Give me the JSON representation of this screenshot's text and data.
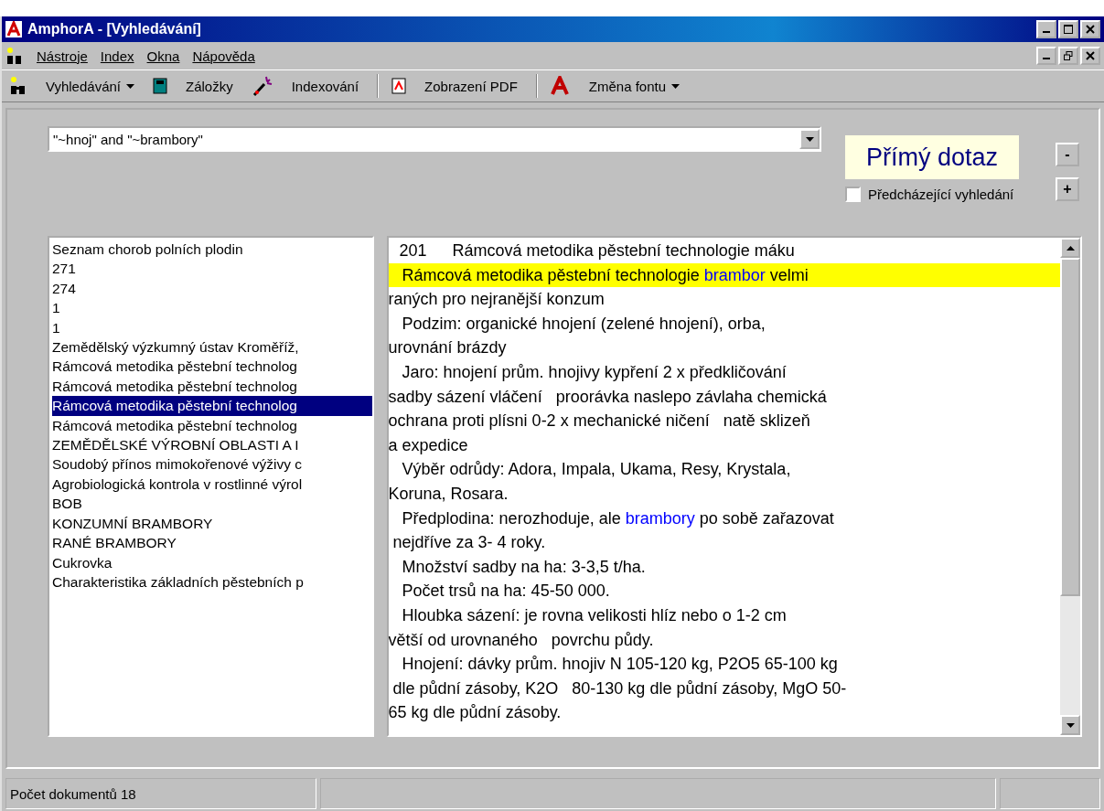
{
  "window": {
    "title": "AmphorA - [Vyhledávání]"
  },
  "menu": [
    {
      "label": "Nástroje"
    },
    {
      "label": "Index"
    },
    {
      "label": "Okna"
    },
    {
      "label": "Nápověda"
    }
  ],
  "toolbar": [
    {
      "kind": "icon"
    },
    {
      "kind": "dropdown",
      "label": "Vyhledávání"
    },
    {
      "kind": "icon"
    },
    {
      "kind": "text",
      "label": "Záložky"
    },
    {
      "kind": "icon"
    },
    {
      "kind": "text",
      "label": "Indexování"
    },
    {
      "kind": "separator"
    },
    {
      "kind": "icon"
    },
    {
      "kind": "text",
      "label": "Zobrazení PDF"
    },
    {
      "kind": "separator"
    },
    {
      "kind": "icon"
    },
    {
      "kind": "dropdown",
      "label": "Změna fontu"
    }
  ],
  "query": {
    "value": "\"~hnoj\" and \"~brambory\""
  },
  "direct_query_button": "Přímý dotaz",
  "previous_search": {
    "label": "Předcházející vyhledání",
    "checked": false
  },
  "zoom_buttons": [
    "-",
    "+"
  ],
  "results": [
    {
      "label": "Seznam chorob polních plodin",
      "selected": false
    },
    {
      "label": "271",
      "selected": false
    },
    {
      "label": "274",
      "selected": false
    },
    {
      "label": "1",
      "selected": false
    },
    {
      "label": "1",
      "selected": false
    },
    {
      "label": "Zemědělský výzkumný ústav Kroměříž,",
      "selected": false
    },
    {
      "label": "Rámcová metodika pěstební technolog",
      "selected": false
    },
    {
      "label": "Rámcová metodika pěstební technolog",
      "selected": false
    },
    {
      "label": "Rámcová metodika pěstební technolog",
      "selected": true
    },
    {
      "label": "Rámcová metodika pěstební technolog",
      "selected": false
    },
    {
      "label": "ZEMĚDĚLSKÉ VÝROBNÍ OBLASTI A I",
      "selected": false
    },
    {
      "label": "Soudobý přínos mimokořenové výživy c",
      "selected": false
    },
    {
      "label": "Agrobiologická kontrola v rostlinné výrol",
      "selected": false
    },
    {
      "label": "BOB",
      "selected": false
    },
    {
      "label": "KONZUMNÍ BRAMBORY",
      "selected": false
    },
    {
      "label": "RANÉ BRAMBORY",
      "selected": false
    },
    {
      "label": "Cukrovka",
      "selected": false
    },
    {
      "label": "Charakteristika základních pěstebních p",
      "selected": false
    }
  ],
  "document": [
    {
      "kind": "heading",
      "segments": [
        {
          "text": "201",
          "match": false
        },
        {
          "text": "Rámcová metodika pěstební technologie máku",
          "match": false
        }
      ]
    },
    {
      "kind": "highlight",
      "segments": [
        {
          "text": "   Rámcová metodika pěstební technologie ",
          "match": false
        },
        {
          "text": "brambor",
          "match": true
        },
        {
          "text": " velmi",
          "match": false
        }
      ]
    },
    {
      "kind": "text",
      "segments": [
        {
          "text": "raných pro nejranější konzum",
          "match": false
        }
      ]
    },
    {
      "kind": "text",
      "segments": [
        {
          "text": "   Podzim: organické hnojení (zelené hnojení), orba,",
          "match": false
        }
      ]
    },
    {
      "kind": "text",
      "segments": [
        {
          "text": "urovnání brázdy",
          "match": false
        }
      ]
    },
    {
      "kind": "text",
      "segments": [
        {
          "text": "   Jaro: hnojení prům. hnojivy kypření 2 x předkličování",
          "match": false
        }
      ]
    },
    {
      "kind": "text",
      "segments": [
        {
          "text": "sadby sázení vláčení   proorávka naslepo závlaha chemická",
          "match": false
        }
      ]
    },
    {
      "kind": "text",
      "segments": [
        {
          "text": "ochrana proti plísni 0-2 x mechanické ničení   natě sklizeň",
          "match": false
        }
      ]
    },
    {
      "kind": "text",
      "segments": [
        {
          "text": "a expedice",
          "match": false
        }
      ]
    },
    {
      "kind": "text",
      "segments": [
        {
          "text": "   Výběr odrůdy: Adora, Impala, Ukama, Resy, Krystala,",
          "match": false
        }
      ]
    },
    {
      "kind": "text",
      "segments": [
        {
          "text": "Koruna, Rosara.",
          "match": false
        }
      ]
    },
    {
      "kind": "text",
      "segments": [
        {
          "text": "   Předplodina: nerozhoduje, ale ",
          "match": false
        },
        {
          "text": "brambory",
          "match": true
        },
        {
          "text": " po sobě zařazovat",
          "match": false
        }
      ]
    },
    {
      "kind": "text",
      "segments": [
        {
          "text": " nejdříve za 3- 4 roky.",
          "match": false
        }
      ]
    },
    {
      "kind": "text",
      "segments": [
        {
          "text": "   Množství sadby na ha: 3-3,5 t/ha.",
          "match": false
        }
      ]
    },
    {
      "kind": "text",
      "segments": [
        {
          "text": "   Počet trsů na ha: 45-50 000.",
          "match": false
        }
      ]
    },
    {
      "kind": "text",
      "segments": [
        {
          "text": "   Hloubka sázení: je rovna velikosti hlíz nebo o 1-2 cm",
          "match": false
        }
      ]
    },
    {
      "kind": "text",
      "segments": [
        {
          "text": "větší od urovnaného   povrchu půdy.",
          "match": false
        }
      ]
    },
    {
      "kind": "text",
      "segments": [
        {
          "text": "   Hnojení: dávky prům. hnojiv N 105-120 kg, P2O5 65-100 kg",
          "match": false
        }
      ]
    },
    {
      "kind": "text",
      "segments": [
        {
          "text": " dle půdní zásoby, K2O   80-130 kg dle půdní zásoby, MgO 50-",
          "match": false
        }
      ]
    },
    {
      "kind": "text",
      "segments": [
        {
          "text": "65 kg dle půdní zásoby.",
          "match": false
        }
      ]
    }
  ],
  "status_bar": {
    "text": "Počet dokumentů  18"
  }
}
